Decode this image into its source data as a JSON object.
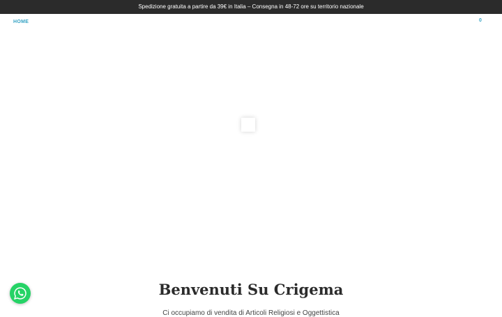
{
  "announcement": {
    "text": "Spedizione gratuita a partire da 39€ in Italia – Consegna in 48-72 ore su territorio nazionale"
  },
  "nav": {
    "home_label": "HOME"
  },
  "cart": {
    "count": "0"
  },
  "hero": {
    "title": "Benvenuti Su Crigema",
    "subtitle": "Ci occupiamo di vendita di Articoli Religiosi e Oggettistica"
  },
  "colors": {
    "accent": "#36a3c4",
    "topbar_bg": "#2b2b2b",
    "whatsapp": "#25d366"
  },
  "icons": {
    "cart": "shopping-bag-icon",
    "chat": "whatsapp-icon"
  }
}
